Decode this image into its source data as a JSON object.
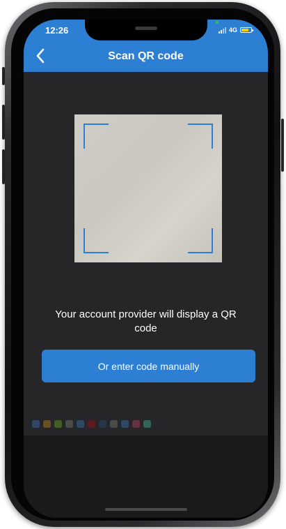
{
  "status_bar": {
    "time": "12:26",
    "network": "4G",
    "battery_level": 0.8
  },
  "header": {
    "back_icon": "chevron-left-icon",
    "title": "Scan QR code"
  },
  "scanner": {
    "frame_icon": "scan-frame-corners-icon"
  },
  "instruction": "Your account provider will display a QR code",
  "actions": {
    "manual_label": "Or enter code manually"
  },
  "colors": {
    "accent": "#2d7fd3",
    "screen_background": "#262628",
    "battery": "#f5d000"
  }
}
